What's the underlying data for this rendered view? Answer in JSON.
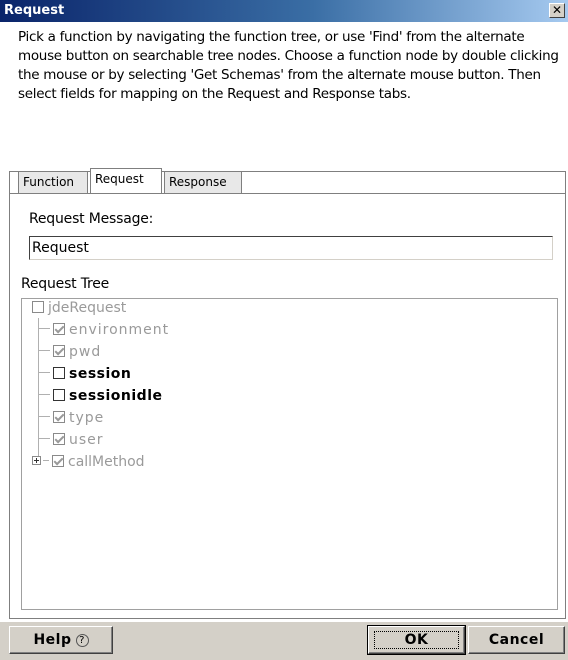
{
  "window": {
    "title": "Request",
    "close_glyph": "✕"
  },
  "description": "Pick a function by navigating the function tree, or use 'Find' from the alternate mouse button on searchable tree nodes. Choose a function node by double clicking the mouse or by selecting 'Get Schemas' from the alternate mouse button. Then select fields for mapping on the Request and Response tabs.",
  "tabs": [
    {
      "label": "Function",
      "active": false
    },
    {
      "label": "Request",
      "active": true
    },
    {
      "label": "Response",
      "active": false
    }
  ],
  "request_message": {
    "label": "Request Message:",
    "value": "Request"
  },
  "tree": {
    "label": "Request Tree",
    "root": {
      "label": "jdeRequest",
      "checked": false
    },
    "children": [
      {
        "label": "environment",
        "checked": true,
        "style": "grey"
      },
      {
        "label": "pwd",
        "checked": true,
        "style": "grey"
      },
      {
        "label": "session",
        "checked": false,
        "style": "bold"
      },
      {
        "label": "sessionidle",
        "checked": false,
        "style": "bold"
      },
      {
        "label": "type",
        "checked": true,
        "style": "grey"
      },
      {
        "label": "user",
        "checked": true,
        "style": "grey"
      },
      {
        "label": "callMethod",
        "checked": true,
        "style": "grey",
        "expandable": true
      }
    ]
  },
  "buttons": {
    "help": "Help",
    "help_icon": "?",
    "ok": "OK",
    "cancel": "Cancel"
  }
}
